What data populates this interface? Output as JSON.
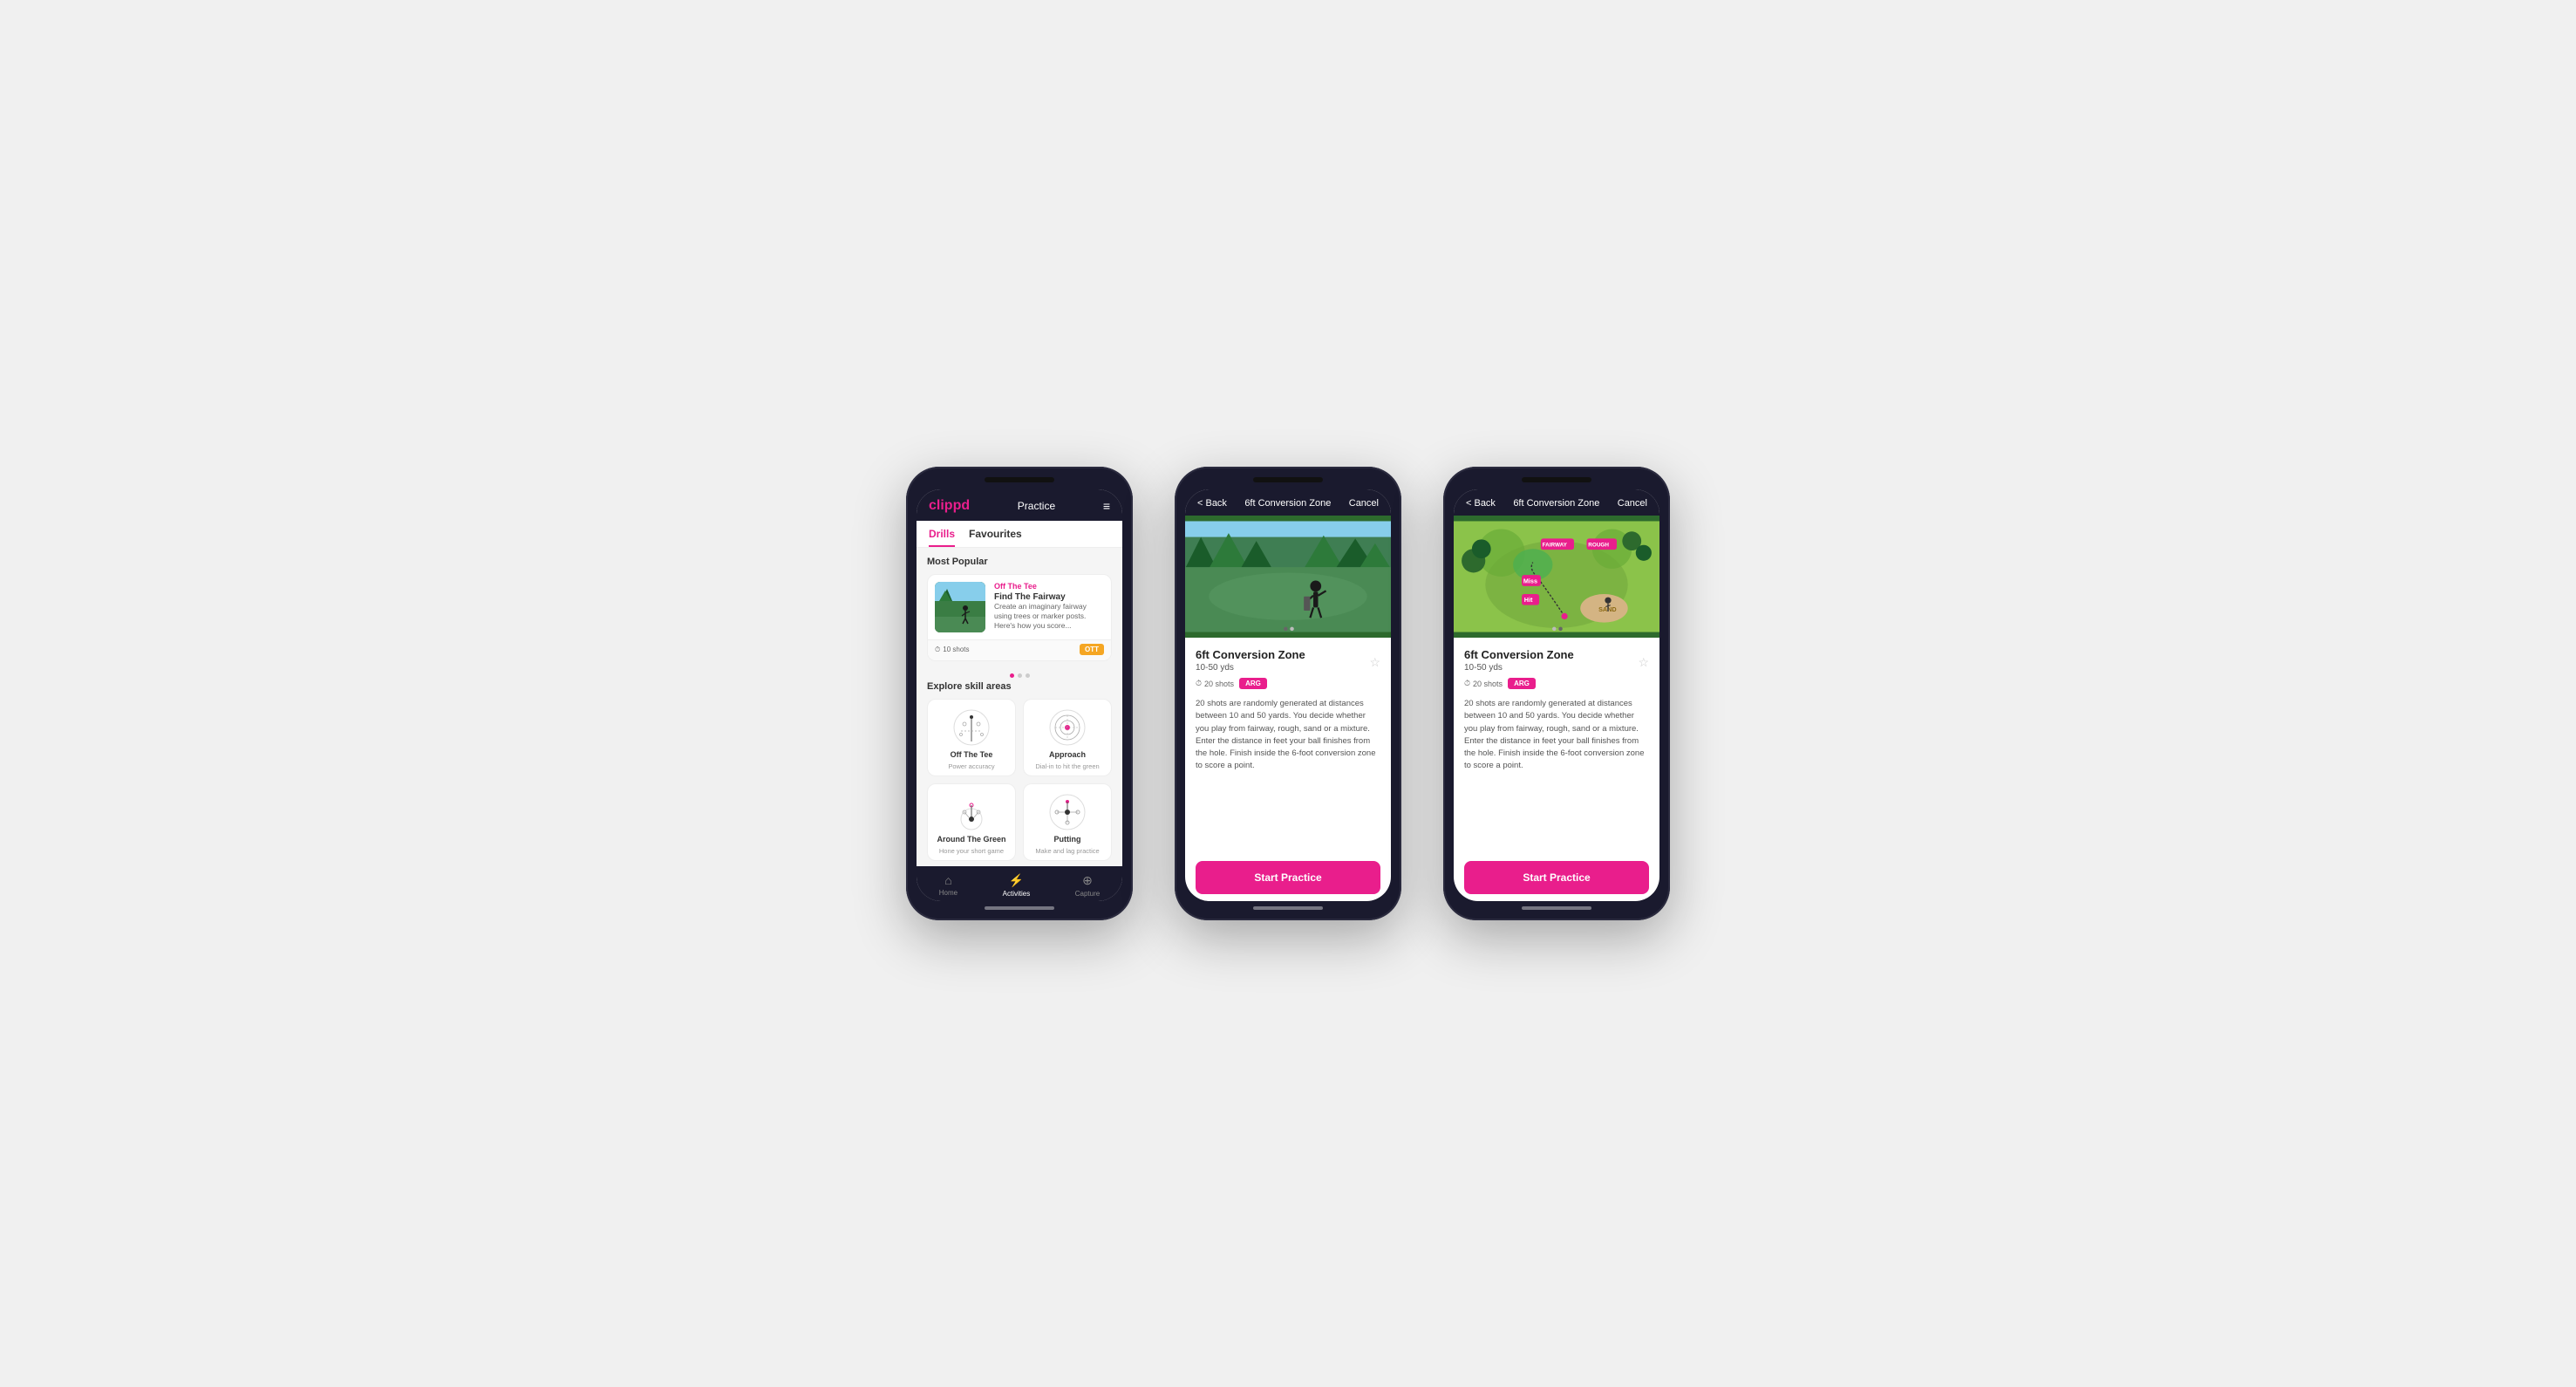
{
  "phone1": {
    "header": {
      "logo": "clippd",
      "title": "Practice",
      "menu_icon": "≡"
    },
    "tabs": [
      {
        "label": "Drills",
        "active": true
      },
      {
        "label": "Favourites",
        "active": false
      }
    ],
    "most_popular_label": "Most Popular",
    "card": {
      "title": "Find The Fairway",
      "subtitle": "Off The Tee",
      "description": "Create an imaginary fairway using trees or marker posts. Here's how you score...",
      "shots": "10 shots",
      "badge": "OTT",
      "dots": [
        true,
        false,
        false
      ]
    },
    "explore_label": "Explore skill areas",
    "skills": [
      {
        "name": "Off The Tee",
        "desc": "Power accuracy"
      },
      {
        "name": "Approach",
        "desc": "Dial-in to hit the green"
      },
      {
        "name": "Around The Green",
        "desc": "Hone your short game"
      },
      {
        "name": "Putting",
        "desc": "Make and lag practice"
      }
    ],
    "bottom_nav": [
      {
        "label": "Home",
        "icon": "⌂",
        "active": false
      },
      {
        "label": "Activities",
        "icon": "⚡",
        "active": true
      },
      {
        "label": "Capture",
        "icon": "⊕",
        "active": false
      }
    ]
  },
  "phone2": {
    "header": {
      "back_label": "< Back",
      "title": "6ft Conversion Zone",
      "cancel_label": "Cancel"
    },
    "drill": {
      "title": "6ft Conversion Zone",
      "range": "10-50 yds",
      "shots": "20 shots",
      "badge": "ARG",
      "description": "20 shots are randomly generated at distances between 10 and 50 yards. You decide whether you play from fairway, rough, sand or a mixture. Enter the distance in feet your ball finishes from the hole. Finish inside the 6-foot conversion zone to score a point.",
      "dots": [
        true,
        false
      ],
      "start_label": "Start Practice"
    }
  },
  "phone3": {
    "header": {
      "back_label": "< Back",
      "title": "6ft Conversion Zone",
      "cancel_label": "Cancel"
    },
    "drill": {
      "title": "6ft Conversion Zone",
      "range": "10-50 yds",
      "shots": "20 shots",
      "badge": "ARG",
      "description": "20 shots are randomly generated at distances between 10 and 50 yards. You decide whether you play from fairway, rough, sand or a mixture. Enter the distance in feet your ball finishes from the hole. Finish inside the 6-foot conversion zone to score a point.",
      "dots": [
        false,
        true
      ],
      "start_label": "Start Practice"
    }
  }
}
